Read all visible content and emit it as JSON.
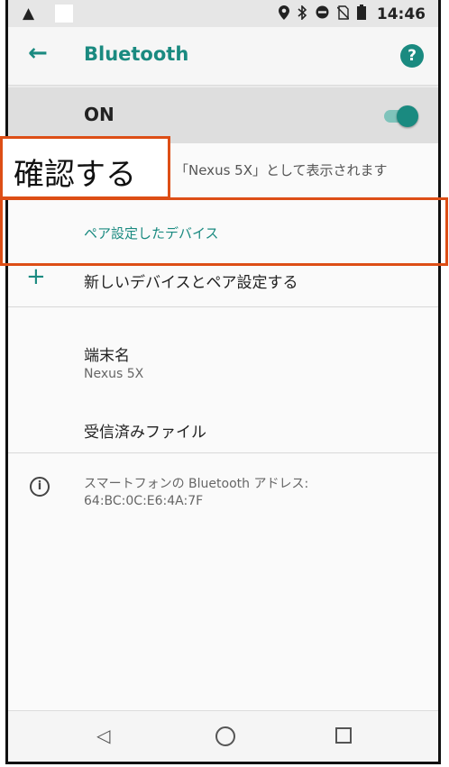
{
  "status_bar": {
    "time": "14:46",
    "icons": [
      "warning-icon",
      "location-icon",
      "bluetooth-icon",
      "dnd-icon",
      "no-sim-icon",
      "battery-icon"
    ]
  },
  "app_bar": {
    "title": "Bluetooth",
    "back_icon": "arrow-left-icon",
    "help_label": "?"
  },
  "toggle_row": {
    "label": "ON",
    "state": true,
    "accent": "#1a8a80"
  },
  "visible_as": "「Nexus 5X」として表示されます",
  "paired_section_header": "ペア設定したデバイス",
  "pair_new": {
    "icon": "+",
    "label": "新しいデバイスとペア設定する"
  },
  "device_name": {
    "title": "端末名",
    "value": "Nexus 5X"
  },
  "received_files": "受信済みファイル",
  "info": {
    "icon": "i",
    "text": "スマートフォンの Bluetooth アドレス: 64:BC:0C:E6:4A:7F"
  },
  "callout": {
    "label": "確認する",
    "color": "#dd4e16"
  },
  "nav": {
    "back": "◁"
  }
}
